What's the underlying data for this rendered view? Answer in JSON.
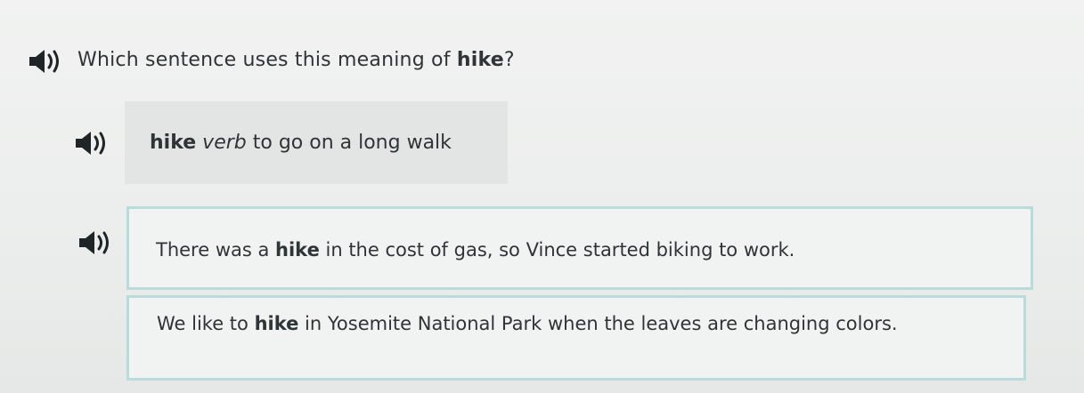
{
  "question": {
    "before": "Which sentence uses this meaning of ",
    "keyword": "hike",
    "after": "?"
  },
  "definition": {
    "word": "hike",
    "part_of_speech": "verb",
    "meaning": " to go on a long walk"
  },
  "options": [
    {
      "before": "There was a ",
      "keyword": "hike",
      "after": " in the cost of gas, so Vince started biking to work."
    },
    {
      "before": "We like to ",
      "keyword": "hike",
      "after": " in Yosemite National Park when the leaves are changing colors."
    }
  ],
  "icons": {
    "audio": "speaker-icon"
  },
  "colors": {
    "text": "#2f3436",
    "option_border": "#b9dcda",
    "definition_bg": "#e2e5e4",
    "icon": "#1f2426"
  }
}
